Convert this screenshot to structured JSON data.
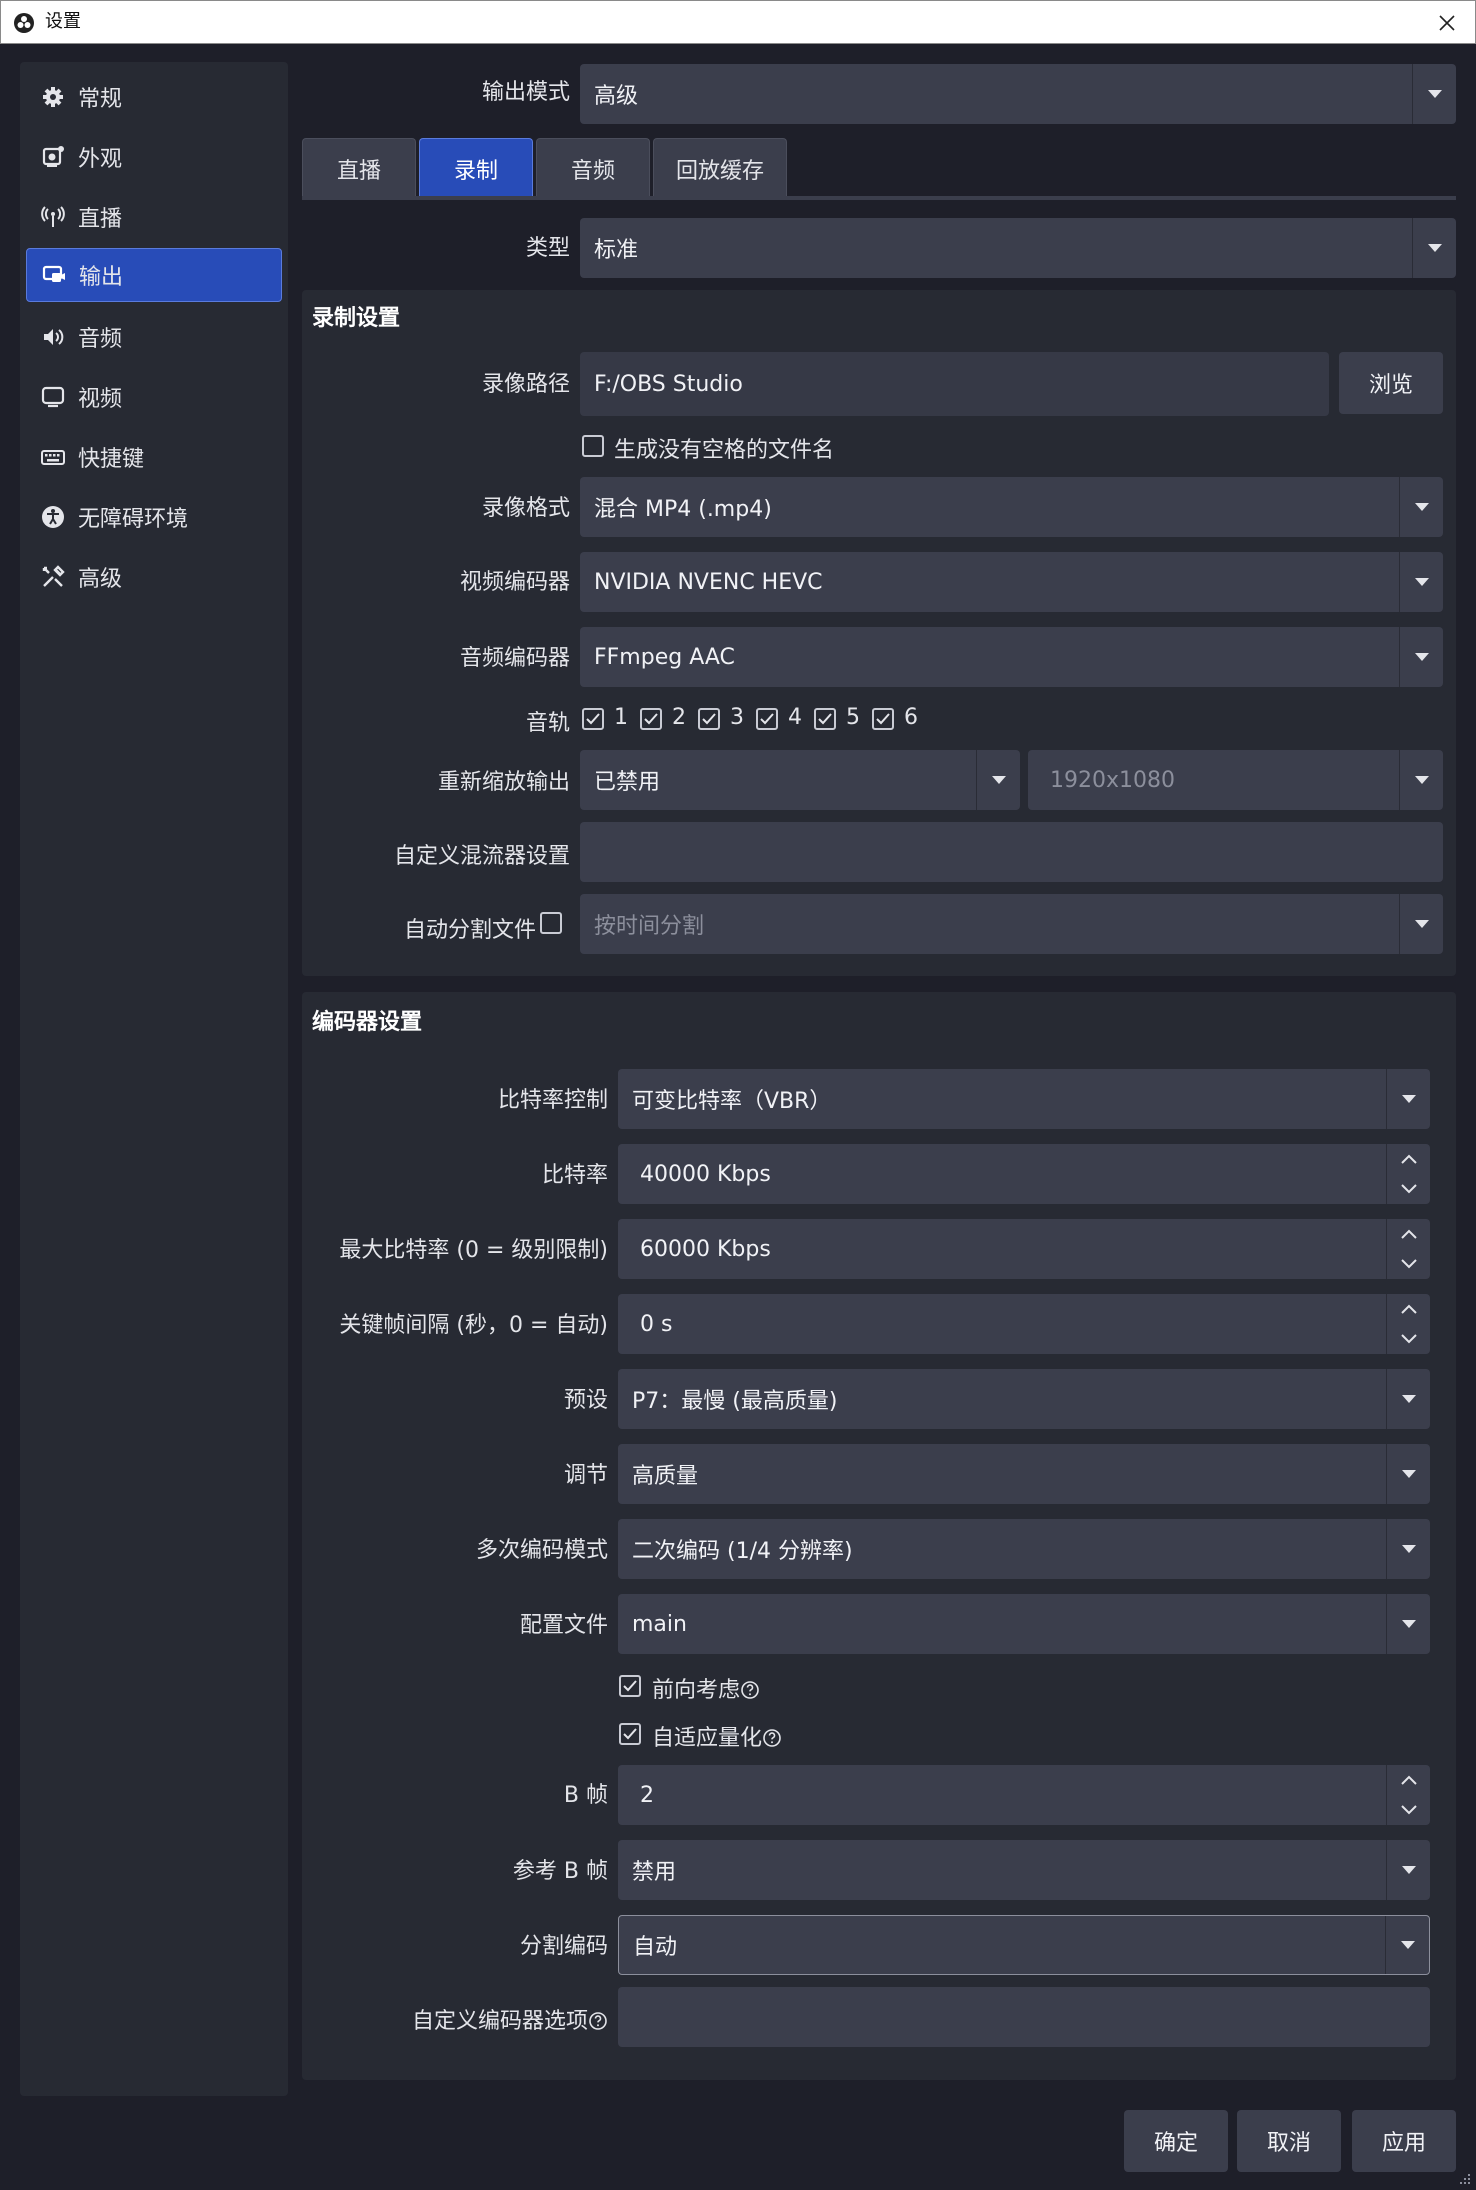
{
  "window": {
    "title": "设置"
  },
  "sidebar": {
    "items": [
      {
        "label": "常规",
        "icon": "gear-icon"
      },
      {
        "label": "外观",
        "icon": "appearance-icon"
      },
      {
        "label": "直播",
        "icon": "broadcast-icon"
      },
      {
        "label": "输出",
        "icon": "output-icon",
        "active": true
      },
      {
        "label": "音频",
        "icon": "speaker-icon"
      },
      {
        "label": "视频",
        "icon": "monitor-icon"
      },
      {
        "label": "快捷键",
        "icon": "keyboard-icon"
      },
      {
        "label": "无障碍环境",
        "icon": "accessibility-icon"
      },
      {
        "label": "高级",
        "icon": "tools-icon"
      }
    ]
  },
  "output_mode": {
    "label": "输出模式",
    "value": "高级"
  },
  "tabs": [
    {
      "label": "直播"
    },
    {
      "label": "录制",
      "active": true
    },
    {
      "label": "音频"
    },
    {
      "label": "回放缓存"
    }
  ],
  "type": {
    "label": "类型",
    "value": "标准"
  },
  "recording": {
    "title": "录制设置",
    "path_label": "录像路径",
    "path_value": "F:/OBS Studio",
    "browse": "浏览",
    "no_space_label": "生成没有空格的文件名",
    "format_label": "录像格式",
    "format_value": "混合 MP4 (.mp4)",
    "video_encoder_label": "视频编码器",
    "video_encoder_value": "NVIDIA NVENC HEVC",
    "audio_encoder_label": "音频编码器",
    "audio_encoder_value": "FFmpeg AAC",
    "tracks_label": "音轨",
    "tracks": [
      "1",
      "2",
      "3",
      "4",
      "5",
      "6"
    ],
    "rescale_label": "重新缩放输出",
    "rescale_value": "已禁用",
    "rescale_res": "1920x1080",
    "muxer_label": "自定义混流器设置",
    "muxer_value": "",
    "split_label": "自动分割文件",
    "split_value": "按时间分割"
  },
  "encoder": {
    "title": "编码器设置",
    "rate_control_label": "比特率控制",
    "rate_control_value": "可变比特率（VBR）",
    "bitrate_label": "比特率",
    "bitrate_value": "40000 Kbps",
    "max_bitrate_label": "最大比特率 (0 = 级别限制)",
    "max_bitrate_value": "60000 Kbps",
    "keyint_label": "关键帧间隔 (秒，0 = 自动)",
    "keyint_value": "0 s",
    "preset_label": "预设",
    "preset_value": "P7：最慢 (最高质量)",
    "tune_label": "调节",
    "tune_value": "高质量",
    "multipass_label": "多次编码模式",
    "multipass_value": "二次编码 (1/4 分辨率)",
    "profile_label": "配置文件",
    "profile_value": "main",
    "lookahead_label": "前向考虑",
    "aq_label": "自适应量化",
    "bframes_label": "B 帧",
    "bframes_value": "2",
    "bref_label": "参考 B 帧",
    "bref_value": "禁用",
    "split_encode_label": "分割编码",
    "split_encode_value": "自动",
    "custom_opts_label": "自定义编码器选项",
    "custom_opts_value": ""
  },
  "footer": {
    "ok": "确定",
    "cancel": "取消",
    "apply": "应用"
  },
  "colors": {
    "accent": "#284cb8",
    "panel": "#272a33",
    "field": "#3b3e4c",
    "background": "#1e1f29"
  }
}
